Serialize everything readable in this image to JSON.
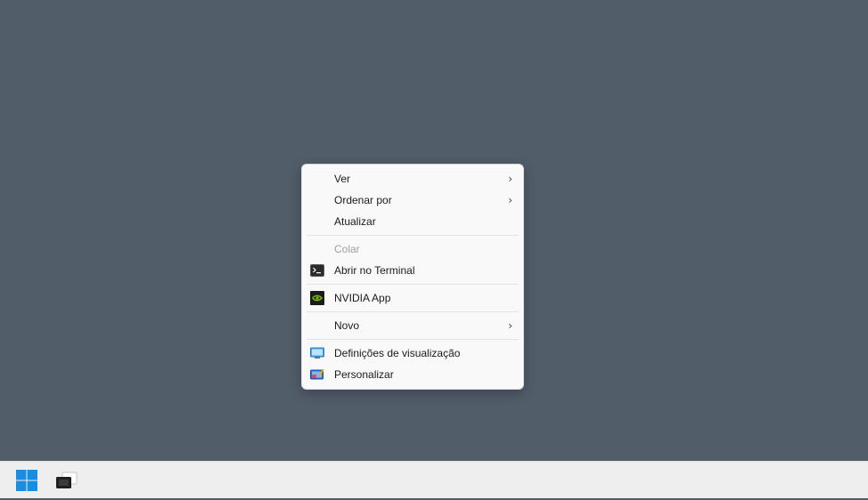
{
  "context_menu": {
    "items": [
      {
        "label": "Ver"
      },
      {
        "label": "Ordenar por"
      },
      {
        "label": "Atualizar"
      },
      {
        "label": "Colar"
      },
      {
        "label": "Abrir no Terminal",
        "icon": "terminal-icon"
      },
      {
        "label": "NVIDIA App",
        "icon": "nvidia-icon"
      },
      {
        "label": "Novo"
      },
      {
        "label": "Definições de visualização",
        "icon": "display-settings-icon"
      },
      {
        "label": "Personalizar",
        "icon": "personalize-icon"
      }
    ],
    "submenu_indicator": "›"
  },
  "taskbar": {
    "buttons": [
      {
        "name": "start-button",
        "icon": "windows-logo-icon"
      },
      {
        "name": "task-view-button",
        "icon": "task-view-icon"
      }
    ]
  },
  "colors": {
    "desktop_background": "#525d6a",
    "menu_background": "#f9f9f9",
    "taskbar_background": "#eeeeee",
    "windows_accent": "#1a8de0",
    "nvidia_green": "#76b900"
  }
}
